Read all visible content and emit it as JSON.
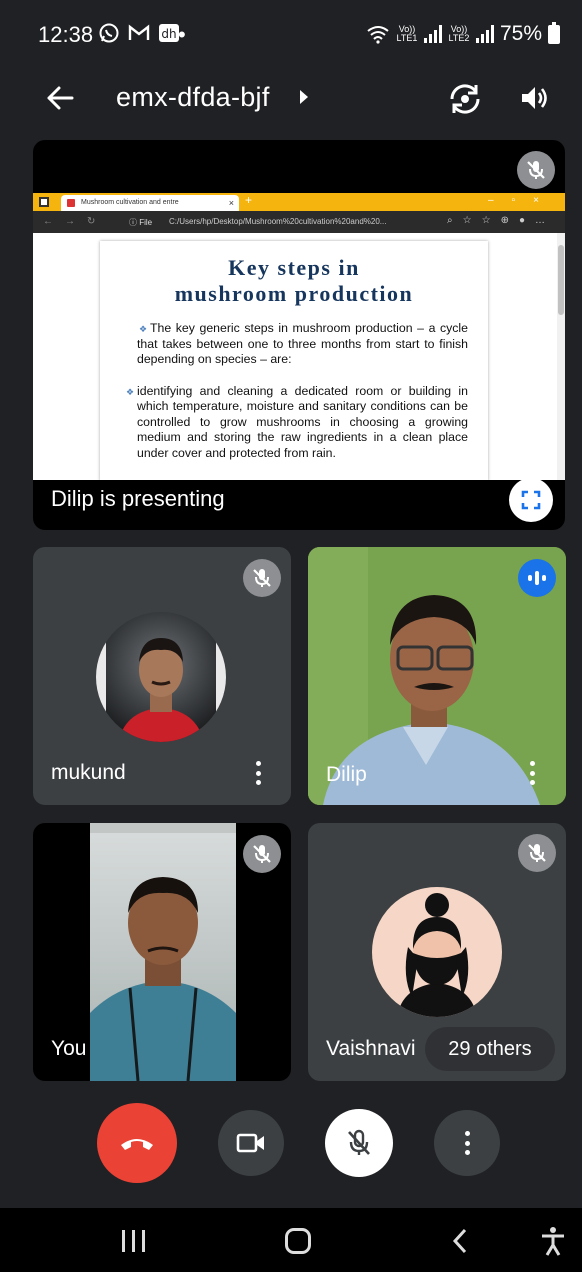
{
  "status_bar": {
    "time": "12:38",
    "notification_icons": [
      "whatsapp-icon",
      "gmail-icon",
      "dailyhunt-icon"
    ],
    "sim1_label": "Vo)) LTE1",
    "sim2_label": "Vo)) LTE2",
    "battery": "75%"
  },
  "app_bar": {
    "meeting_code": "emx-dfda-bjf"
  },
  "presentation": {
    "browser_tab_title": "Mushroom cultivation and entre",
    "address_file_label": "File",
    "address_url": "C:/Users/hp/Desktop/Mushroom%20cultivation%20and%20...",
    "slide_title_line1": "Key steps in",
    "slide_title_line2": "mushroom production",
    "bullet1": "The key generic steps in mushroom production – a cycle that takes between one to three months from start to finish depending on species – are:",
    "bullet2": "identifying and cleaning a dedicated room or building in which temperature, moisture and sanitary conditions can be controlled to grow mushrooms in choosing a growing medium and storing the raw ingredients in a clean place under cover and protected from rain.",
    "presenter_label": "Dilip is presenting"
  },
  "participants": {
    "mukund": {
      "name": "mukund",
      "muted": true
    },
    "dilip": {
      "name": "Dilip",
      "speaking": true
    },
    "you": {
      "name": "You",
      "muted": true
    },
    "vaishnavi": {
      "name": "Vaishnavi",
      "muted": true
    }
  },
  "others_label": "29 others",
  "colors": {
    "background": "#202124",
    "tile": "#3c4043",
    "end_call": "#ea4335",
    "speaking": "#1a73e8",
    "browser_tabbar": "#f6b40f",
    "slide_title": "#17365d"
  }
}
